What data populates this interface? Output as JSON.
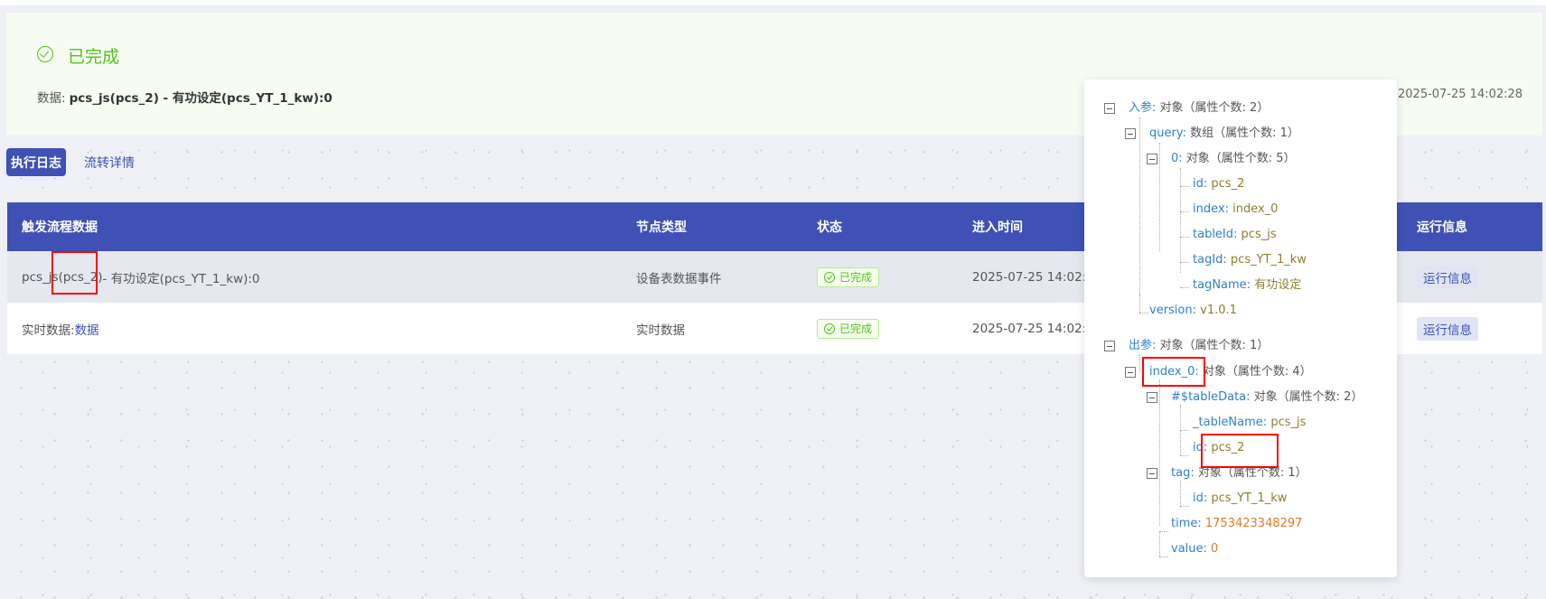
{
  "status": {
    "title": "已完成",
    "data_label": "数据:",
    "data_value": "pcs_js(pcs_2) - 有功设定(pcs_YT_1_kw):0",
    "time": "2025-07-25 14:02:28",
    "color": "#52c41a"
  },
  "tabs": [
    {
      "label": "执行日志",
      "active": true
    },
    {
      "label": "流转详情",
      "active": false
    }
  ],
  "table": {
    "headers": [
      "触发流程数据",
      "节点类型",
      "状态",
      "进入时间",
      "运行信息"
    ],
    "rows": [
      {
        "trigger_prefix": "pcs_js",
        "trigger_mid": "(pcs_2)",
        "trigger_suffix": " - 有功设定(pcs_YT_1_kw):0",
        "type": "设备表数据事件",
        "status": "已完成",
        "time": "2025-07-25 14:02:28",
        "action": "运行信息"
      },
      {
        "trigger_label": "实时数据: ",
        "trigger_link": "数据",
        "type": "实时数据",
        "status": "已完成",
        "time": "2025-07-25 14:02:28",
        "action": "运行信息"
      }
    ]
  },
  "popup": {
    "input_key": "入参:",
    "input_desc": "对象（属性个数: 2）",
    "query_key": "query:",
    "query_desc": "数组（属性个数: 1）",
    "item0_key": "0:",
    "item0_desc": "对象（属性个数: 5）",
    "id_key": "id:",
    "id_val": "pcs_2",
    "index_key": "index:",
    "index_val": "index_0",
    "tableId_key": "tableId:",
    "tableId_val": "pcs_js",
    "tagId_key": "tagId:",
    "tagId_val": "pcs_YT_1_kw",
    "tagName_key": "tagName:",
    "tagName_val": "有功设定",
    "version_key": "version:",
    "version_val": "v1.0.1",
    "output_key": "出参:",
    "output_desc": "对象（属性个数: 1）",
    "index0_key": "index_0:",
    "index0_desc": "对象（属性个数: 4）",
    "tableData_key": "#$tableData:",
    "tableData_desc": "对象（属性个数: 2）",
    "tableName_key": "_tableName:",
    "tableName_val": "pcs_js",
    "out_id_key": "id:",
    "out_id_val": "pcs_2",
    "tag_key": "tag:",
    "tag_desc": "对象（属性个数: 1）",
    "tag_id_key": "id:",
    "tag_id_val": "pcs_YT_1_kw",
    "time_key": "time:",
    "time_val": "1753423348297",
    "value_key": "value:",
    "value_val": "0"
  },
  "colors": {
    "primary": "#3f51b5",
    "success": "#52c41a",
    "highlight": "#ff0000"
  }
}
